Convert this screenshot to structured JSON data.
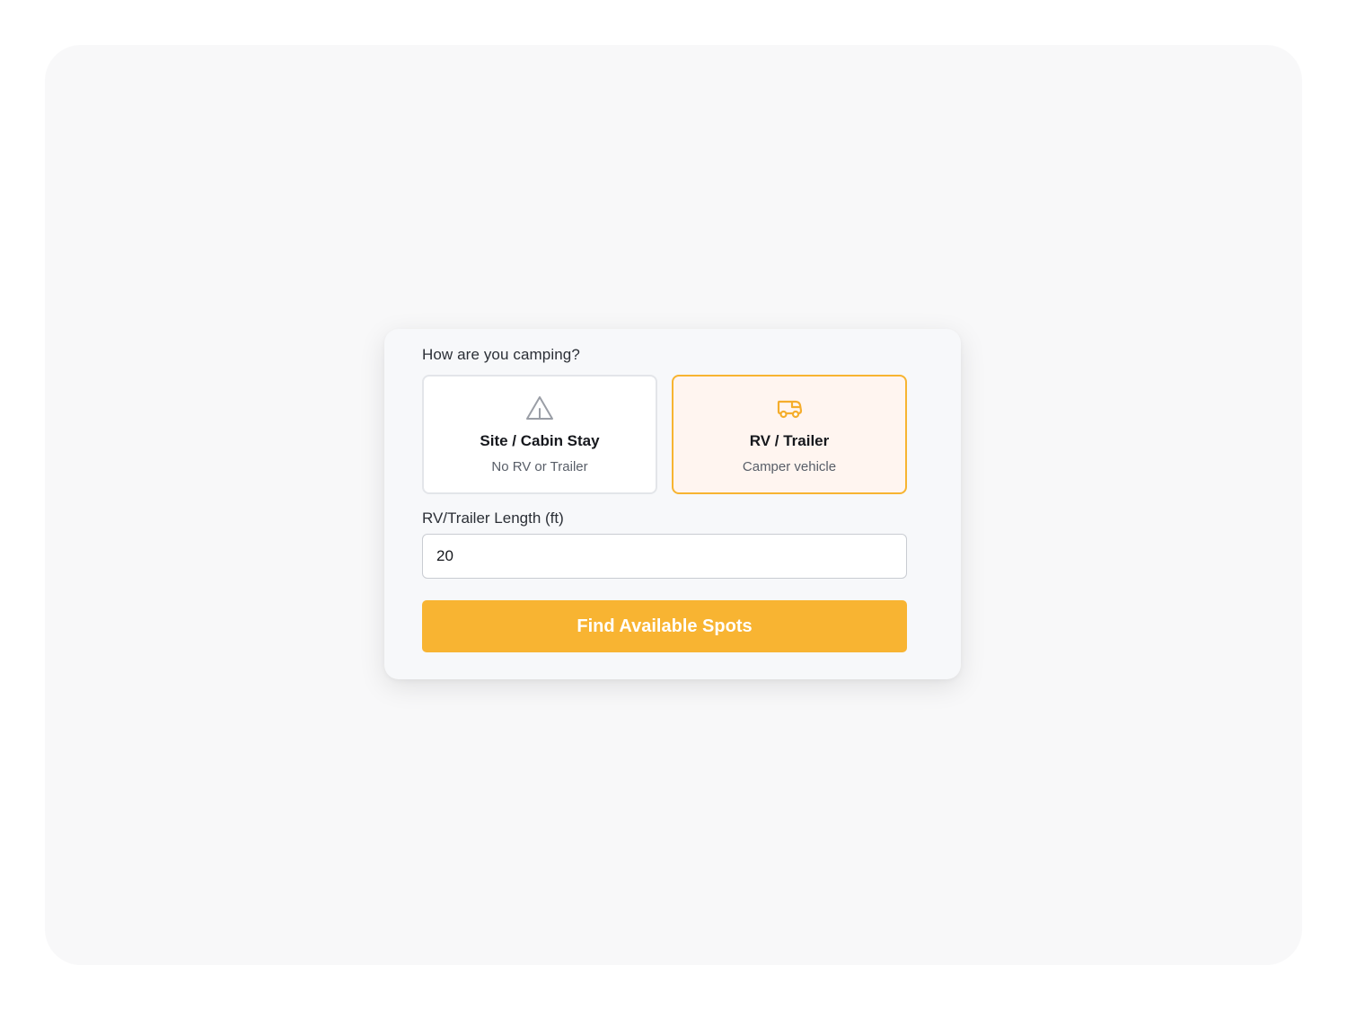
{
  "form": {
    "question": "How are you camping?",
    "options": [
      {
        "icon": "tent-icon",
        "title": "Site / Cabin Stay",
        "subtitle": "No RV or Trailer",
        "selected": false
      },
      {
        "icon": "rv-icon",
        "title": "RV / Trailer",
        "subtitle": "Camper vehicle",
        "selected": true
      }
    ],
    "length_label": "RV/Trailer Length (ft)",
    "length_value": "20",
    "submit_label": "Find Available Spots"
  },
  "colors": {
    "accent": "#f8b432",
    "selected_bg": "#fff5f0",
    "page_bg": "#f8f8f9",
    "card_bg": "#f7f8fa"
  }
}
